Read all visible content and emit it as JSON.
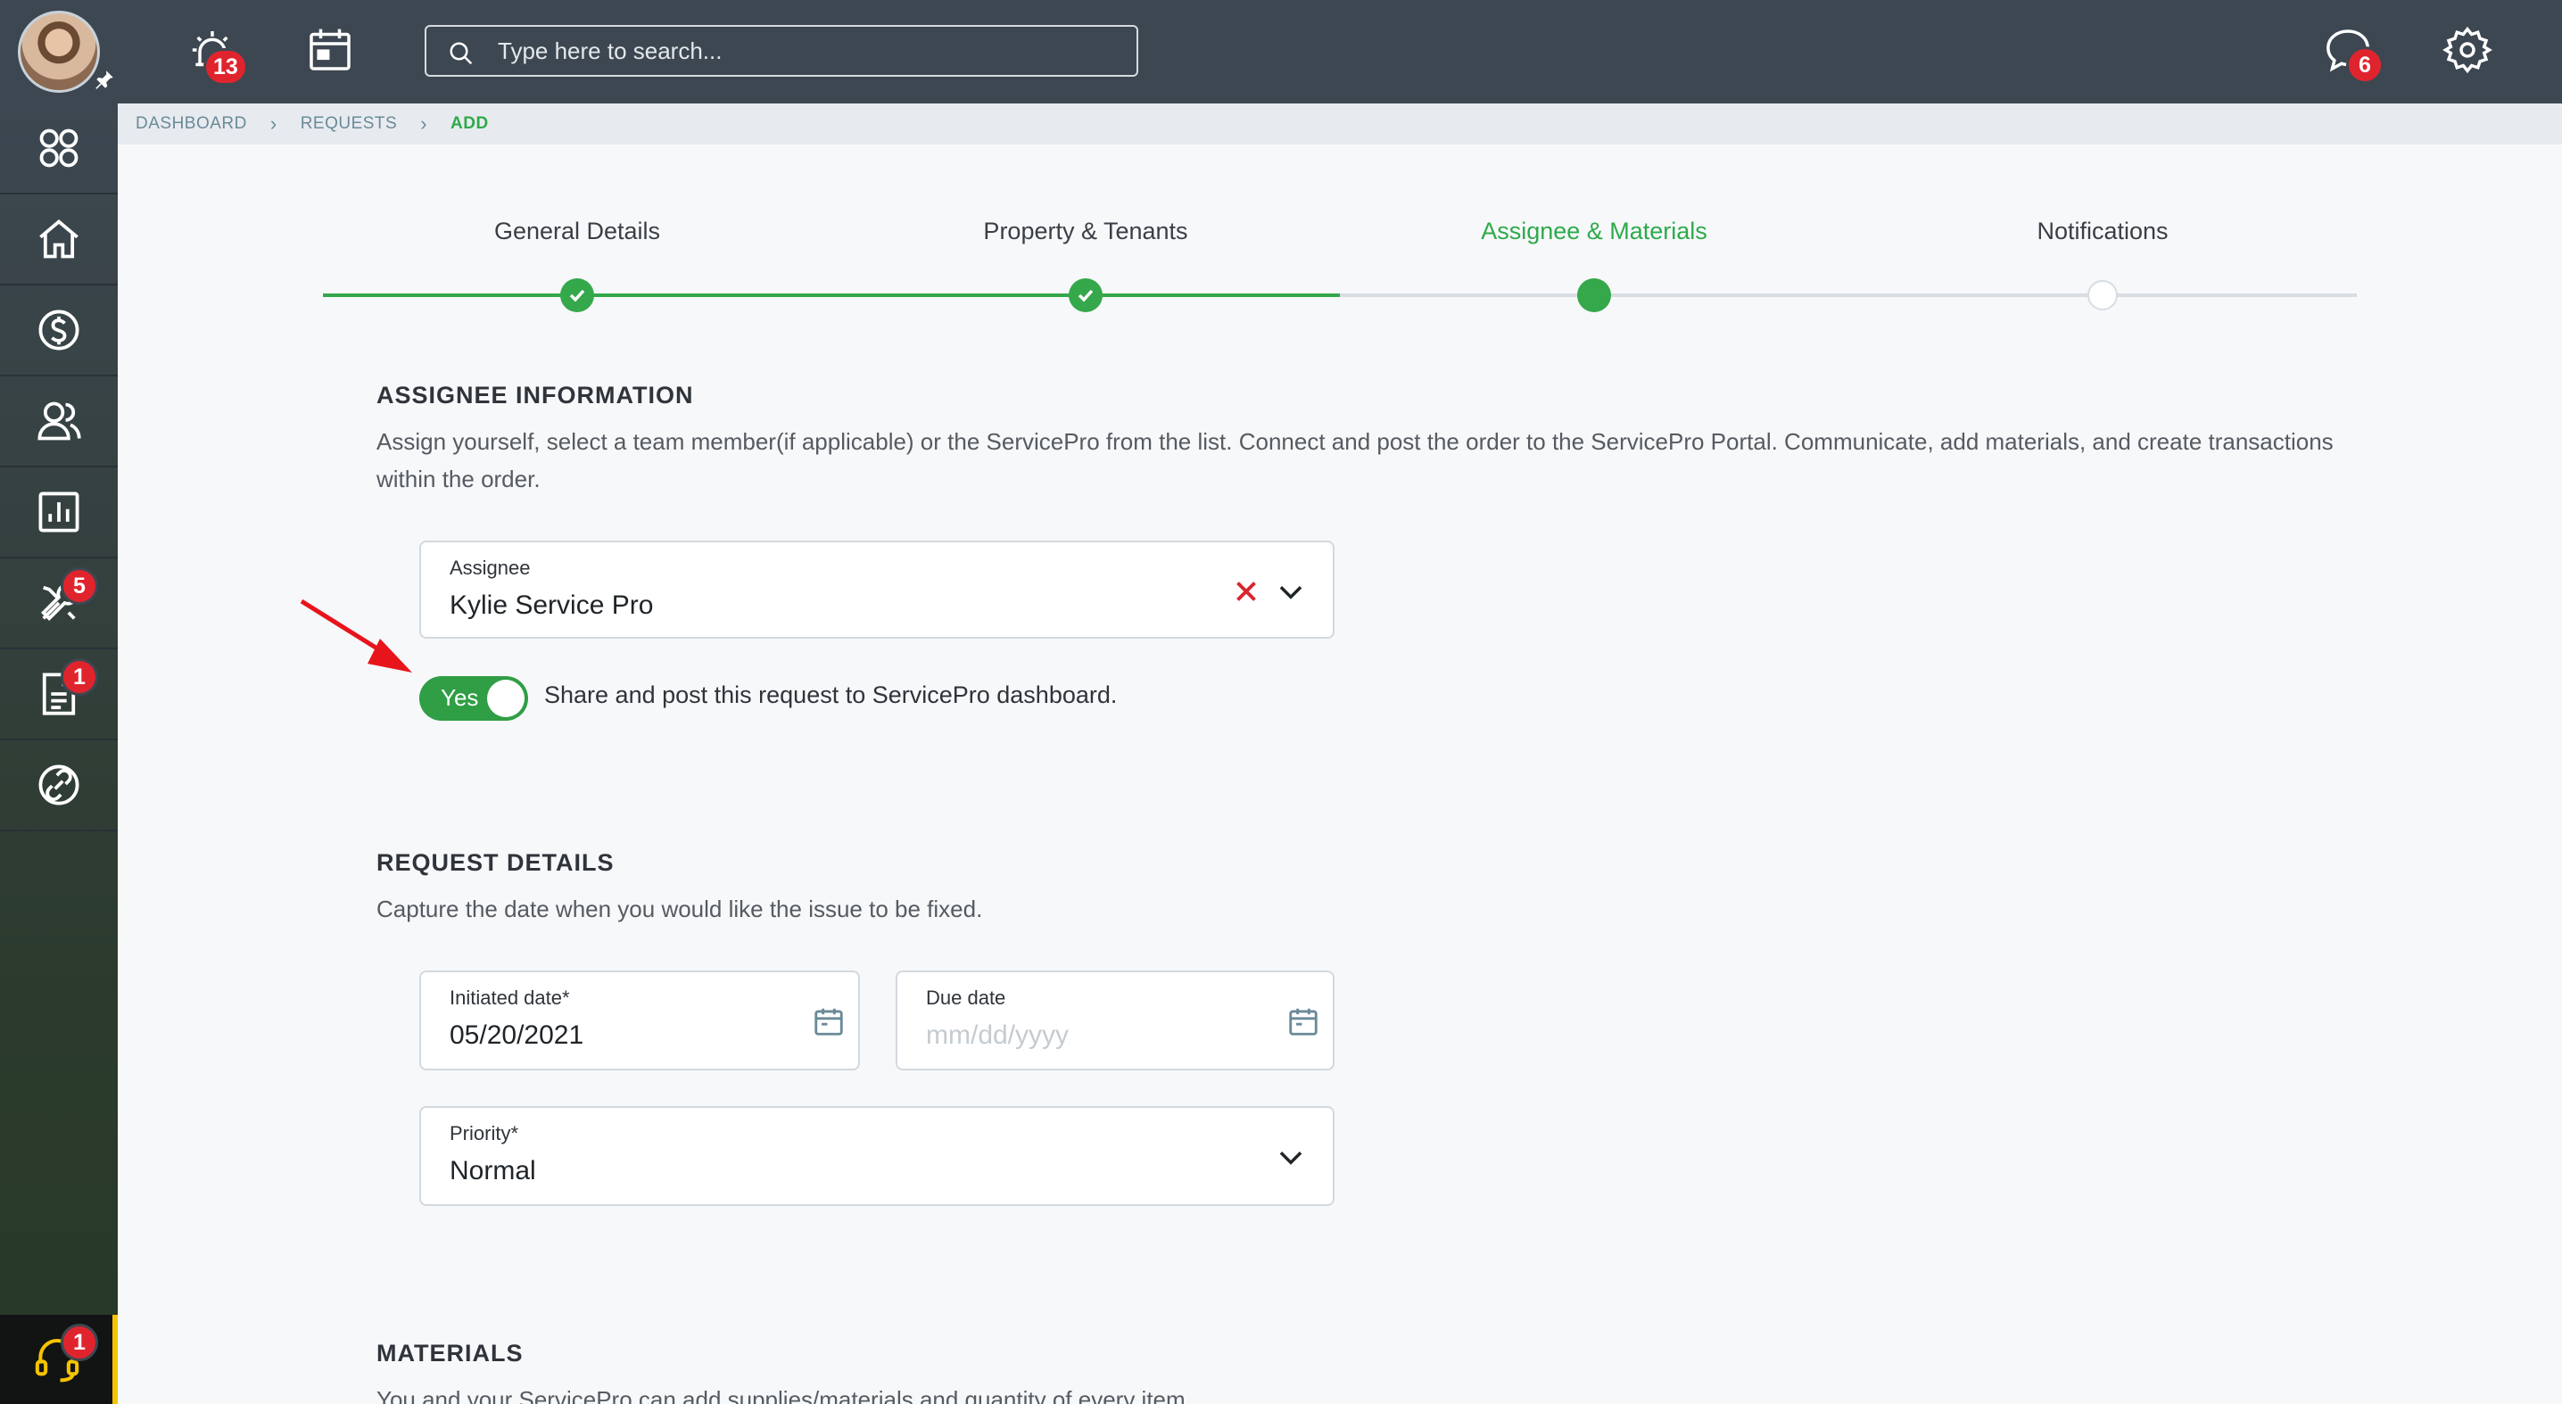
{
  "header": {
    "alerts_badge": "13",
    "search_placeholder": "Type here to search...",
    "messages_badge": "6"
  },
  "sidebar": {
    "items": [
      {
        "name": "dashboard-icon"
      },
      {
        "name": "home-icon"
      },
      {
        "name": "dollar-icon"
      },
      {
        "name": "users-icon"
      },
      {
        "name": "reports-icon"
      },
      {
        "name": "tools-icon",
        "badge": "5"
      },
      {
        "name": "document-icon",
        "badge": "1"
      },
      {
        "name": "link-icon"
      }
    ],
    "help_badge": "1"
  },
  "breadcrumb": [
    "DASHBOARD",
    "REQUESTS",
    "ADD"
  ],
  "steps": [
    {
      "label": "General Details",
      "state": "done"
    },
    {
      "label": "Property & Tenants",
      "state": "done"
    },
    {
      "label": "Assignee & Materials",
      "state": "current"
    },
    {
      "label": "Notifications",
      "state": "todo"
    }
  ],
  "assignee_section": {
    "title": "ASSIGNEE INFORMATION",
    "description": "Assign yourself, select a team member(if applicable) or the ServicePro from the list. Connect and post the order to the ServicePro Portal. Communicate, add materials, and create transactions within the order.",
    "assignee_label": "Assignee",
    "assignee_value": "Kylie Service Pro",
    "toggle_label": "Yes",
    "toggle_caption": "Share and post this request to ServicePro dashboard."
  },
  "request_section": {
    "title": "REQUEST DETAILS",
    "description": "Capture the date when you would like the issue to be fixed.",
    "initiated_label": "Initiated date*",
    "initiated_value": "05/20/2021",
    "due_label": "Due date",
    "due_placeholder": "mm/dd/yyyy",
    "priority_label": "Priority*",
    "priority_value": "Normal"
  },
  "materials_section": {
    "title": "MATERIALS",
    "description": "You and your ServicePro can add supplies/materials and quantity of every item."
  },
  "colors": {
    "accent_green": "#34a84a",
    "topbar": "#3d4751",
    "badge_red": "#e0242d",
    "clear_red": "#d9262e",
    "annotation_arrow": "#e8141b"
  }
}
